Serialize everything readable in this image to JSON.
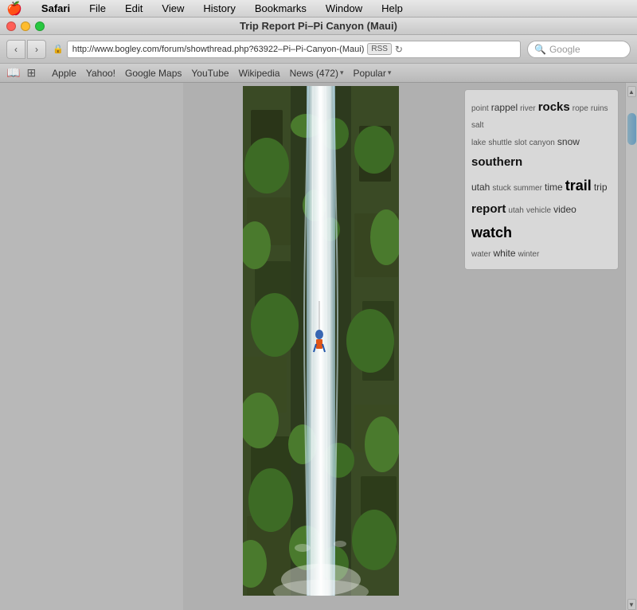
{
  "menubar": {
    "apple": "🍎",
    "items": [
      "Safari",
      "File",
      "Edit",
      "View",
      "History",
      "Bookmarks",
      "Window",
      "Help"
    ]
  },
  "titlebar": {
    "title": "Trip Report Pi–Pi Canyon (Maui)"
  },
  "toolbar": {
    "back_label": "‹",
    "forward_label": "›",
    "address": "http://www.bogley.com/forum/showthread.php?63922–Pi–Pi-Canyon-(Maui)",
    "rss_label": "RSS",
    "reload_label": "↻",
    "search_placeholder": "Google"
  },
  "bookmarks": {
    "icons": [
      "📖",
      "☰"
    ],
    "items": [
      "Apple",
      "Yahoo!",
      "Google Maps",
      "YouTube",
      "Wikipedia"
    ],
    "dropdowns": [
      {
        "label": "News (472)",
        "has_arrow": true
      },
      {
        "label": "Popular",
        "has_arrow": true
      }
    ]
  },
  "tag_cloud": {
    "tags": [
      {
        "word": "point",
        "size": "small"
      },
      {
        "word": "rappel",
        "size": "medium"
      },
      {
        "word": "river",
        "size": "small"
      },
      {
        "word": "rocks",
        "size": "large"
      },
      {
        "word": "rope",
        "size": "small"
      },
      {
        "word": "ruins",
        "size": "small"
      },
      {
        "word": "salt",
        "size": "small"
      },
      {
        "word": "lake",
        "size": "small"
      },
      {
        "word": "shuttle",
        "size": "small"
      },
      {
        "word": "slot",
        "size": "small"
      },
      {
        "word": "canyon",
        "size": "small"
      },
      {
        "word": "snow",
        "size": "medium"
      },
      {
        "word": "southern",
        "size": "large"
      },
      {
        "word": "utah",
        "size": "medium"
      },
      {
        "word": "stuck",
        "size": "small"
      },
      {
        "word": "summer",
        "size": "small"
      },
      {
        "word": "time",
        "size": "medium"
      },
      {
        "word": "trail",
        "size": "xlarge"
      },
      {
        "word": "trip",
        "size": "medium"
      },
      {
        "word": "report",
        "size": "large"
      },
      {
        "word": "utah",
        "size": "small"
      },
      {
        "word": "vehicle",
        "size": "small"
      },
      {
        "word": "video",
        "size": "medium"
      },
      {
        "word": "watch",
        "size": "xlarge"
      },
      {
        "word": "water",
        "size": "small"
      },
      {
        "word": "white",
        "size": "medium"
      },
      {
        "word": "winter",
        "size": "small"
      }
    ]
  }
}
